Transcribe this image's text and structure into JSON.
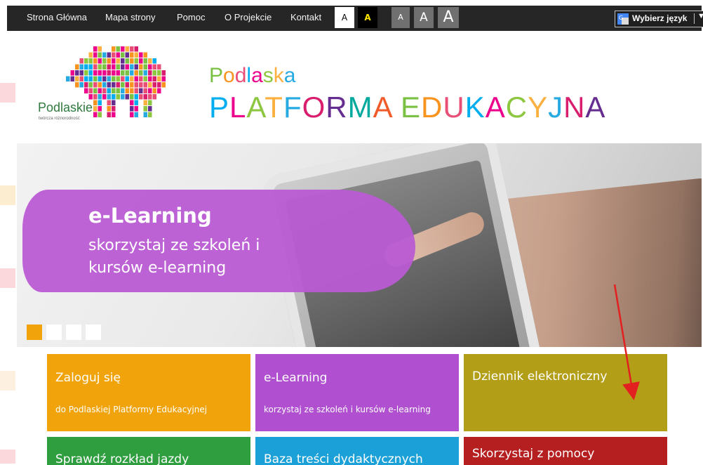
{
  "topnav": {
    "items": [
      "Strona Główna",
      "Mapa strony",
      "Pomoc",
      "O Projekcie",
      "Kontakt"
    ],
    "contrast_normal": "A",
    "contrast_high": "A",
    "size_small": "A",
    "size_medium": "A",
    "size_large": "A",
    "language_label": "Wybierz język"
  },
  "logo": {
    "brand": "Podlaskie",
    "tagline": "twórcza różnorodność"
  },
  "title": {
    "line1": "Podlaska",
    "line2": "PLATFORMA EDUKACYJNA"
  },
  "hero": {
    "title": "e-Learning",
    "subtitle": "skorzystaj ze szkoleń i kursów e-learning"
  },
  "tiles": [
    {
      "title": "Zaloguj się",
      "subtitle": "do Podlaskiej Platformy Edukacyjnej",
      "color": "#f0a30a"
    },
    {
      "title": "e-Learning",
      "subtitle": "korzystaj ze szkoleń i kursów e-learning",
      "color": "#b04fcf"
    },
    {
      "title": "Dziennik elektroniczny",
      "subtitle": "",
      "color": "#b29e17"
    },
    {
      "title": "Sprawdź rozkład jazdy",
      "subtitle": "",
      "color": "#2e9e3e"
    },
    {
      "title": "Baza treści dydaktycznych",
      "subtitle": "",
      "color": "#1ba0d8"
    },
    {
      "title": "Skorzystaj z pomocy",
      "subtitle": "",
      "color": "#b51f1f"
    }
  ],
  "colors": {
    "topbar": "#262626",
    "annotation_arrow": "#e32020",
    "hero_blob": "#b95bd3",
    "slider_active": "#f0a30a"
  },
  "icons": [
    "google-translate-icon",
    "dropdown-arrow-icon",
    "annotation-arrow"
  ]
}
